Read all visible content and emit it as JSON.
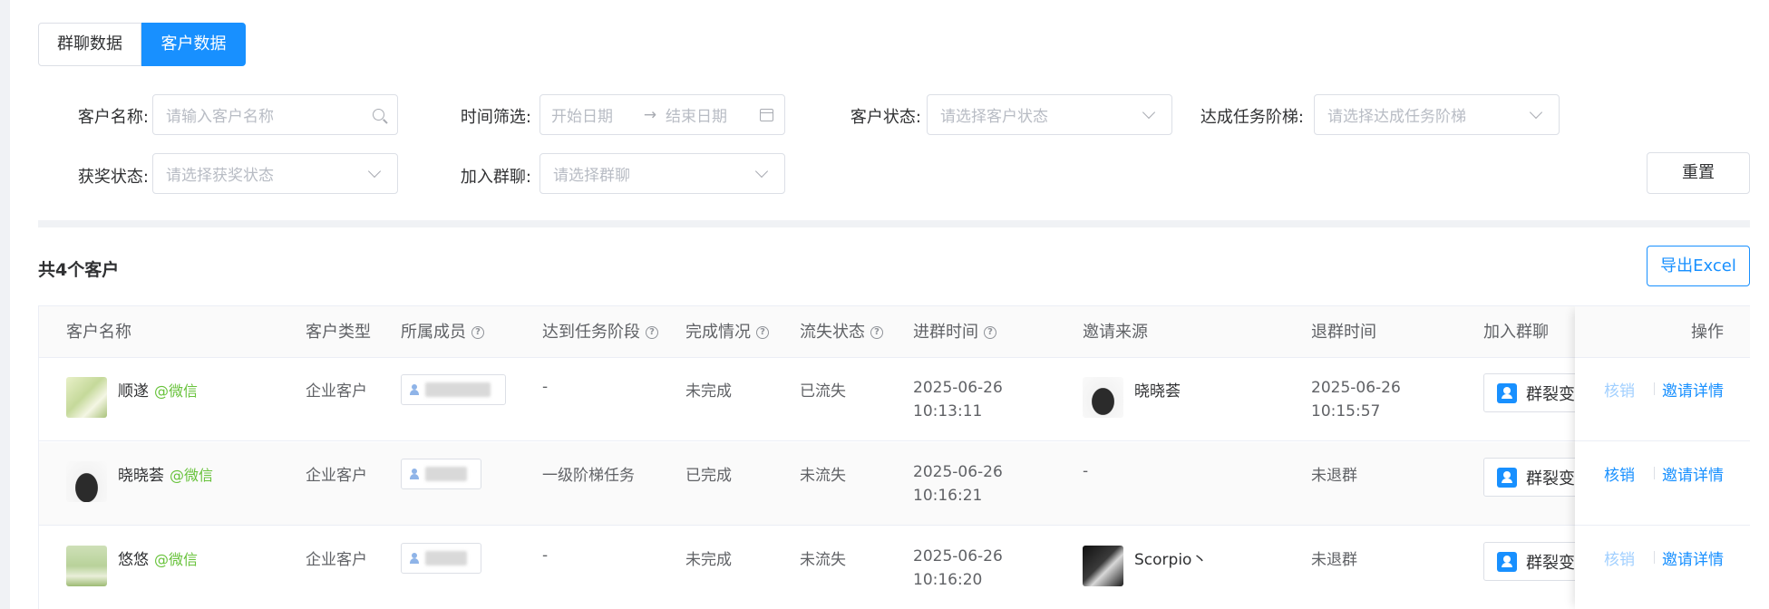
{
  "tabs": [
    {
      "label": "群聊数据",
      "active": false
    },
    {
      "label": "客户数据",
      "active": true
    }
  ],
  "filters": {
    "customer_name": {
      "label": "客户名称:",
      "placeholder": "请输入客户名称"
    },
    "time": {
      "label": "时间筛选:",
      "start_placeholder": "开始日期",
      "separator": "→",
      "end_placeholder": "结束日期"
    },
    "customer_status": {
      "label": "客户状态:",
      "placeholder": "请选择客户状态"
    },
    "task_tier": {
      "label": "达成任务阶梯:",
      "placeholder": "请选择达成任务阶梯"
    },
    "award_status": {
      "label": "获奖状态:",
      "placeholder": "请选择获奖状态"
    },
    "join_group": {
      "label": "加入群聊:",
      "placeholder": "请选择群聊"
    }
  },
  "buttons": {
    "reset": "重置",
    "export": "导出Excel"
  },
  "summary": {
    "total": "共4个客户"
  },
  "table": {
    "columns": [
      "客户名称",
      "客户类型",
      "所属成员",
      "达到任务阶段",
      "完成情况",
      "流失状态",
      "进群时间",
      "邀请来源",
      "退群时间",
      "加入群聊",
      "操作"
    ],
    "rows": [
      {
        "name": "顺遂",
        "source_tag": "@微信",
        "type": "企业客户",
        "member_prefix": "",
        "stage": "-",
        "completion": "未完成",
        "churn": "已流失",
        "join_date": "2025-06-26",
        "join_time": "10:13:11",
        "inviter": "晓晓荟",
        "quit_date": "2025-06-26",
        "quit_time": "10:15:57",
        "group": "群裂变",
        "action_cancel": "核销",
        "action_detail": "邀请详情"
      },
      {
        "name": "晓晓荟",
        "source_tag": "@微信",
        "type": "企业客户",
        "member_prefix": "",
        "stage": "一级阶梯任务",
        "completion": "已完成",
        "churn": "未流失",
        "join_date": "2025-06-26",
        "join_time": "10:16:21",
        "inviter": "-",
        "quit_date": "未退群",
        "quit_time": "",
        "group": "群裂变",
        "action_cancel": "核销",
        "action_detail": "邀请详情"
      },
      {
        "name": "悠悠",
        "source_tag": "@微信",
        "type": "企业客户",
        "member_prefix": "",
        "stage": "-",
        "completion": "未完成",
        "churn": "未流失",
        "join_date": "2025-06-26",
        "join_time": "10:16:20",
        "inviter": "Scorpio丶",
        "quit_date": "未退群",
        "quit_time": "",
        "group": "群裂变",
        "action_cancel": "核销",
        "action_detail": "邀请详情"
      }
    ]
  },
  "colors": {
    "primary": "#1890ff",
    "wechat_green": "#67c23a",
    "disabled_link": "#a0cfff"
  }
}
